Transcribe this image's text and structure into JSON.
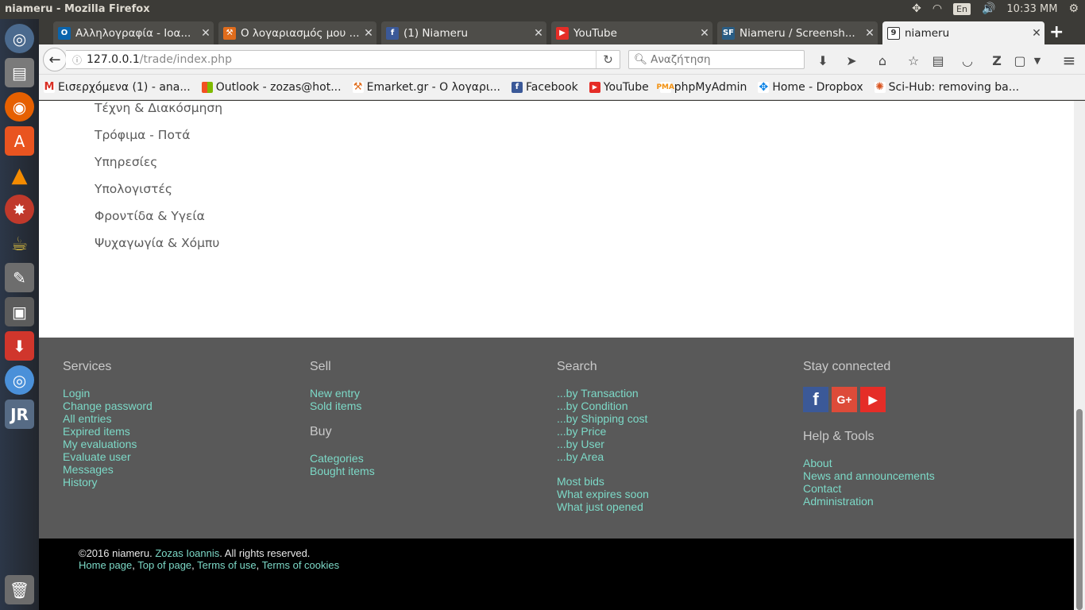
{
  "top_panel": {
    "window_title": "niameru - Mozilla Firefox",
    "keyboard_layout": "En",
    "clock": "10:33 MM"
  },
  "launcher": {
    "items": [
      "dash-icon",
      "files-icon",
      "firefox-icon",
      "software-center-icon",
      "vlc-icon",
      "app-icon",
      "app-icon",
      "gimp-icon",
      "disk-icon",
      "download-icon",
      "chromium-icon",
      "jr-icon",
      "trash-icon"
    ]
  },
  "tabs": [
    {
      "title": "Αλληλογραφία - Ιοα...",
      "icon": "outlook-icon",
      "color": "#0a64ad"
    },
    {
      "title": "Ο λογαριασμός μου ...",
      "icon": "emarket-icon",
      "color": "#e06c1c"
    },
    {
      "title": "(1) Niameru",
      "icon": "facebook-icon",
      "color": "#3b5998"
    },
    {
      "title": "YouTube",
      "icon": "youtube-icon",
      "color": "#e52d27"
    },
    {
      "title": "Niameru / Screensh...",
      "icon": "sourceforge-icon",
      "color": "#2a5d84"
    },
    {
      "title": "niameru",
      "icon": "niameru-icon",
      "color": "#ffffff",
      "active": true
    }
  ],
  "navbar": {
    "url_host": "127.0.0.1",
    "url_path": "/trade/index.php",
    "search_placeholder": "Αναζήτηση"
  },
  "bookmarks": [
    {
      "label": "Εισερχόμενα (1) - ana...",
      "icon": "gmail-icon",
      "color": "#d93025"
    },
    {
      "label": "Outlook - zozas@hot...",
      "icon": "microsoft-icon",
      "color": "#f25022"
    },
    {
      "label": "Emarket.gr - Ο λογαρι...",
      "icon": "emarket-icon",
      "color": "#e06c1c"
    },
    {
      "label": "Facebook",
      "icon": "facebook-icon",
      "color": "#3b5998"
    },
    {
      "label": "YouTube",
      "icon": "youtube-icon",
      "color": "#e52d27"
    },
    {
      "label": "phpMyAdmin",
      "icon": "phpmyadmin-icon",
      "color": "#f29111"
    },
    {
      "label": "Home - Dropbox",
      "icon": "dropbox-icon",
      "color": "#007ee5"
    },
    {
      "label": "Sci-Hub: removing ba...",
      "icon": "scihub-icon",
      "color": "#d9531e"
    }
  ],
  "categories": [
    "Τέχνη & Διακόσμηση",
    "Τρόφιμα - Ποτά",
    "Υπηρεσίες",
    "Υπολογιστές",
    "Φροντίδα & Υγεία",
    "Ψυχαγωγία & Χόμπυ"
  ],
  "footer": {
    "services": {
      "heading": "Services",
      "links": [
        "Login",
        "Change password",
        "All entries",
        "Expired items",
        "My evaluations",
        "Evaluate user",
        "Messages",
        "History"
      ]
    },
    "sell": {
      "heading": "Sell",
      "links": [
        "New entry",
        "Sold items"
      ]
    },
    "buy": {
      "heading": "Buy",
      "links": [
        "Categories",
        "Bought items"
      ]
    },
    "search": {
      "heading": "Search",
      "links": [
        "...by Transaction",
        "...by Condition",
        "...by Shipping cost",
        "...by Price",
        "...by User",
        "...by Area"
      ],
      "links2": [
        "Most bids",
        "What expires soon",
        "What just opened"
      ]
    },
    "stay_connected": {
      "heading": "Stay connected",
      "social": [
        {
          "label": "f",
          "icon": "facebook-icon",
          "color": "#3b5998"
        },
        {
          "label": "G+",
          "icon": "google-plus-icon",
          "color": "#dd4b39"
        },
        {
          "label": "▶",
          "icon": "youtube-icon",
          "color": "#e52d27"
        }
      ]
    },
    "help": {
      "heading": "Help & Tools",
      "links": [
        "About",
        "News and announcements",
        "Contact",
        "Administration"
      ]
    }
  },
  "bottom": {
    "copyright_prefix": "©2016 niameru.",
    "author": "Zozas Ioannis",
    "rights": ". All rights reserved.",
    "links": [
      "Home page",
      "Top of page",
      "Terms of use",
      "Terms of cookies"
    ]
  }
}
